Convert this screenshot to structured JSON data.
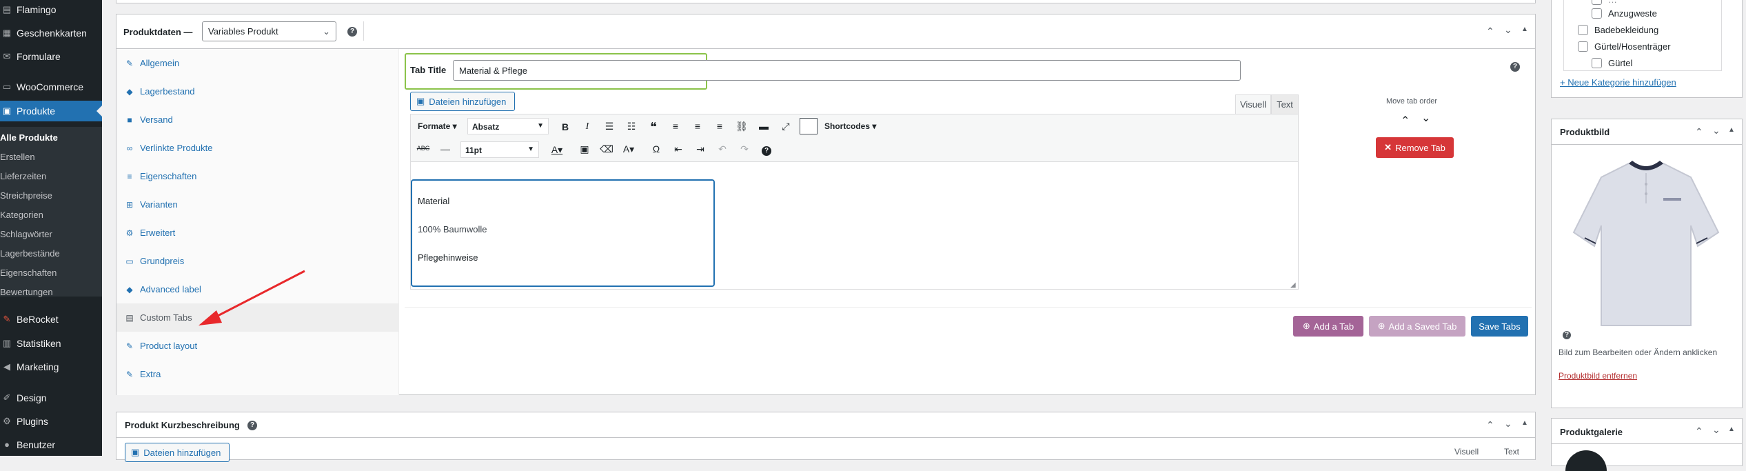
{
  "sidebar": {
    "items": [
      {
        "label": "Flamingo",
        "icon": "flamingo-icon"
      },
      {
        "label": "Geschenkkarten",
        "icon": "gift-card-icon"
      },
      {
        "label": "Formulare",
        "icon": "mail-icon"
      },
      {
        "label": "WooCommerce",
        "icon": "woocommerce-icon"
      },
      {
        "label": "Produkte",
        "icon": "products-icon"
      }
    ],
    "submenu": [
      "Alle Produkte",
      "Erstellen",
      "Lieferzeiten",
      "Streichpreise",
      "Kategorien",
      "Schlagwörter",
      "Lagerbestände",
      "Eigenschaften",
      "Bewertungen"
    ],
    "lower_items": [
      {
        "label": "BeRocket",
        "icon": "berocket-icon"
      },
      {
        "label": "Statistiken",
        "icon": "stats-icon"
      },
      {
        "label": "Marketing",
        "icon": "megaphone-icon"
      },
      {
        "label": "Design",
        "icon": "brush-icon"
      },
      {
        "label": "Plugins",
        "icon": "plugin-icon"
      },
      {
        "label": "Benutzer",
        "icon": "user-icon"
      }
    ]
  },
  "product_data": {
    "title": "Produktdaten —",
    "type_select": "Variables Produkt",
    "tabs": [
      {
        "label": "Allgemein",
        "icon": "wrench-icon"
      },
      {
        "label": "Lagerbestand",
        "icon": "tag-icon"
      },
      {
        "label": "Versand",
        "icon": "truck-icon"
      },
      {
        "label": "Verlinkte Produkte",
        "icon": "link-icon"
      },
      {
        "label": "Eigenschaften",
        "icon": "list-icon"
      },
      {
        "label": "Varianten",
        "icon": "grid-icon"
      },
      {
        "label": "Erweitert",
        "icon": "gear-icon"
      },
      {
        "label": "Grundpreis",
        "icon": "price-icon"
      },
      {
        "label": "Advanced label",
        "icon": "tag-icon"
      },
      {
        "label": "Custom Tabs",
        "icon": "tabs-icon"
      },
      {
        "label": "Product layout",
        "icon": "wrench-icon"
      },
      {
        "label": "Extra",
        "icon": "wrench-icon"
      }
    ],
    "tab_title_label": "Tab Title",
    "tab_title_value": "Material & Pflege",
    "add_media": "Dateien hinzufügen",
    "editor_tab_visual": "Visuell",
    "editor_tab_text": "Text",
    "toolbar": {
      "formats": "Formate",
      "paragraph": "Absatz",
      "shortcodes": "Shortcodes",
      "font_size": "11pt"
    },
    "content_lines": [
      "Material",
      "100% Baumwolle",
      "Pflegehinweise"
    ],
    "move_tab_order": "Move tab order",
    "remove_tab": "Remove Tab",
    "add_tab": "Add a Tab",
    "add_saved_tab": "Add a Saved Tab",
    "save_tabs": "Save Tabs"
  },
  "short_desc": {
    "title": "Produkt Kurzbeschreibung",
    "add_media": "Dateien hinzufügen",
    "tab_visual": "Visuell",
    "tab_text": "Text"
  },
  "categories": {
    "items": [
      "Anzugweste",
      "Badebekleidung",
      "Gürtel/Hosenträger",
      "Gürtel"
    ],
    "add_link": "+ Neue Kategorie hinzufügen"
  },
  "product_image": {
    "title": "Produktbild",
    "hint": "Bild zum Bearbeiten oder Ändern anklicken",
    "remove_link": "Produktbild entfernen"
  },
  "gallery": {
    "title": "Produktgalerie"
  },
  "colors": {
    "admin_bg": "#1d2327",
    "accent": "#2271b1",
    "remove": "#d63638",
    "purple": "#a46497",
    "highlight_green": "#8bc34a",
    "arrow_red": "#e8282b"
  }
}
